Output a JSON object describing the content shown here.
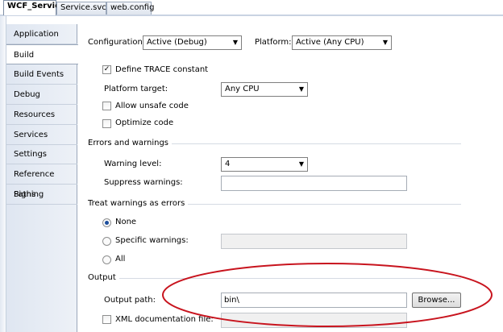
{
  "doc_tabs": [
    "WCF_Service",
    "Service.svc*",
    "web.config"
  ],
  "side_tabs": [
    "Application",
    "Build",
    "Build Events",
    "Debug",
    "Resources",
    "Services",
    "Settings",
    "Reference Paths",
    "Signing"
  ],
  "header": {
    "configuration_label": "Configuration:",
    "configuration_value": "Active (Debug)",
    "platform_label": "Platform:",
    "platform_value": "Active (Any CPU)"
  },
  "general": {
    "define_trace_label": "Define TRACE constant",
    "define_trace_checked": true,
    "platform_target_label": "Platform target:",
    "platform_target_value": "Any CPU",
    "allow_unsafe_label": "Allow unsafe code",
    "optimize_label": "Optimize code"
  },
  "errors": {
    "heading": "Errors and warnings",
    "warning_level_label": "Warning level:",
    "warning_level_value": "4",
    "suppress_label": "Suppress warnings:",
    "suppress_value": ""
  },
  "treat": {
    "heading": "Treat warnings as errors",
    "none_label": "None",
    "specific_label": "Specific warnings:",
    "specific_value": "",
    "all_label": "All",
    "selected": "None"
  },
  "output": {
    "heading": "Output",
    "path_label": "Output path:",
    "path_value": "bin\\",
    "browse_label": "Browse...",
    "xml_doc_label": "XML documentation file:",
    "xml_doc_value": ""
  },
  "colors": {
    "annotation_ellipse": "#c8141e",
    "tab_border": "#9aa7ba",
    "radio_dot": "#1c4e9c"
  }
}
